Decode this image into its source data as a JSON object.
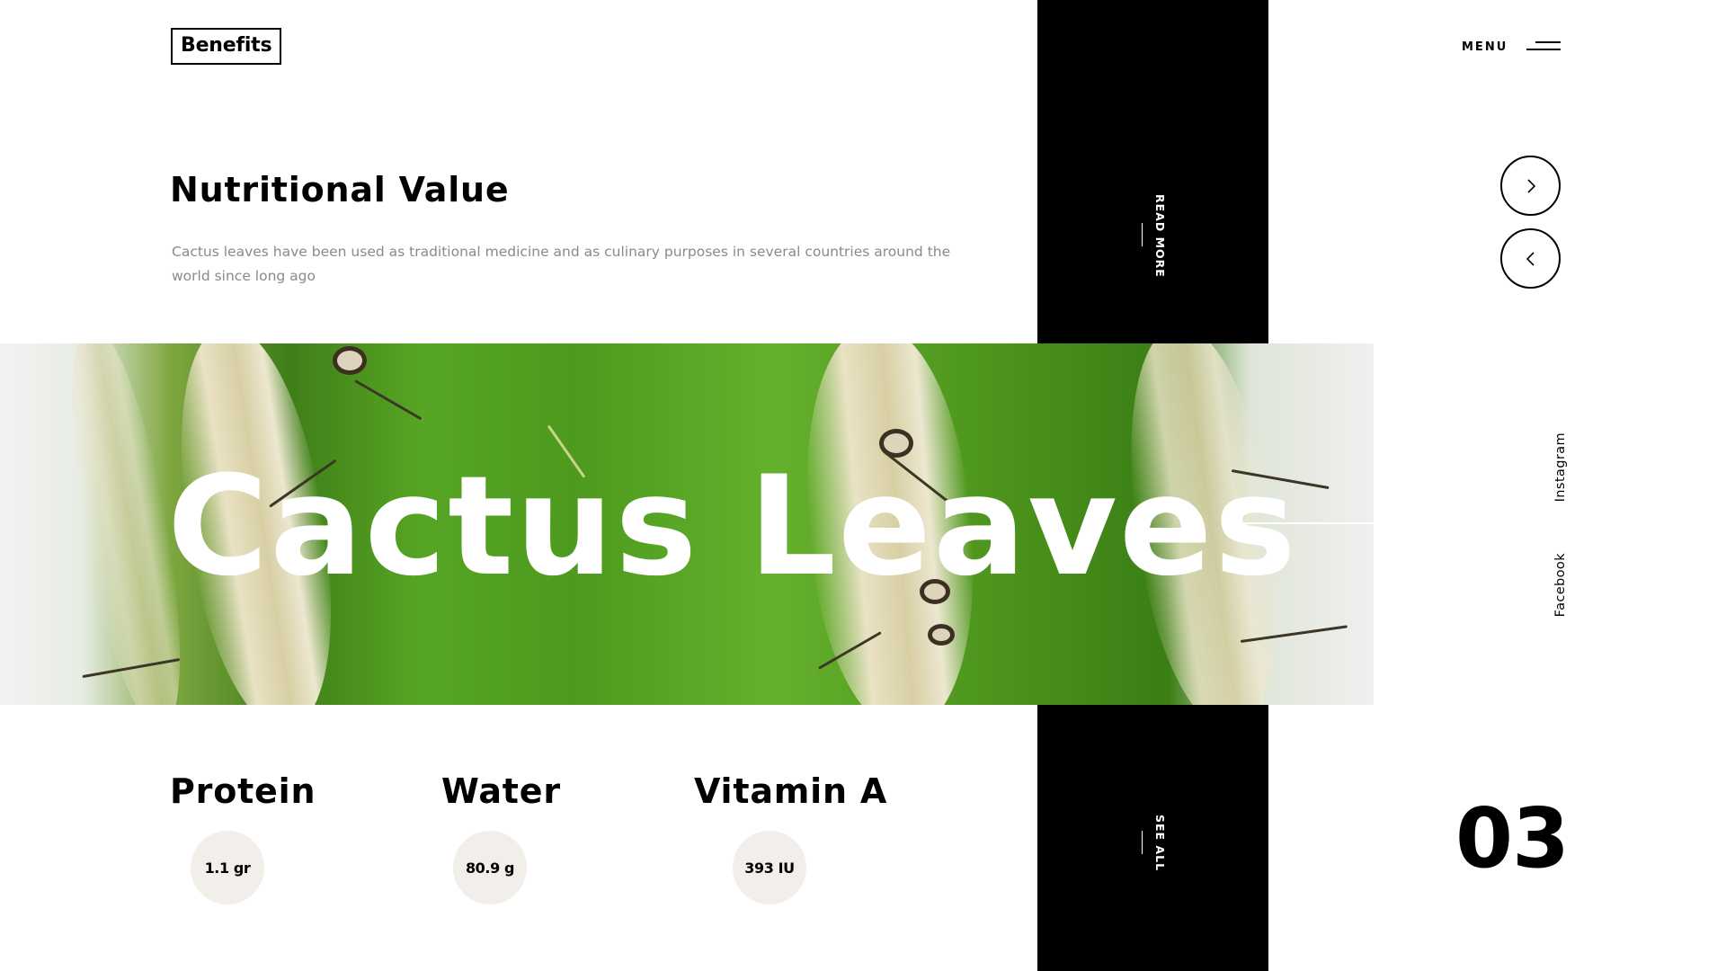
{
  "header": {
    "logo": "Benefits",
    "menu_label": "MENU"
  },
  "intro": {
    "title": "Nutritional Value",
    "description": "Cactus leaves have been used as traditional medicine and as culinary purposes in several countries around the world since long ago"
  },
  "side_links": {
    "read_more": "READ MORE",
    "see_all": "SEE ALL"
  },
  "hero": {
    "title": "Cactus Leaves"
  },
  "navigation": {
    "next_icon": "chevron-right-icon",
    "prev_icon": "chevron-left-icon"
  },
  "social": {
    "instagram": "Instagram",
    "facebook": "Facebook"
  },
  "nutrients": [
    {
      "name": "Protein",
      "value": "1.1 gr"
    },
    {
      "name": "Water",
      "value": "80.9 g"
    },
    {
      "name": "Vitamin A",
      "value": "393 IU"
    }
  ],
  "slide_number": "03",
  "colors": {
    "panel": "#000000",
    "badge_bg": "#f2efea",
    "body_text": "#8a8a8a",
    "accent_green": "#4d9a1e"
  }
}
